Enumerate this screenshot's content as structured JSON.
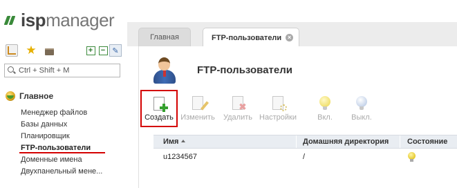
{
  "logo": {
    "part1": "isp",
    "part2": "manager"
  },
  "sidebar": {
    "tools": [
      "tree-icon",
      "star-icon",
      "briefcase-icon",
      "expand-icon",
      "collapse-icon",
      "pin-icon"
    ],
    "search": {
      "placeholder": "Ctrl + Shift + M"
    },
    "group": {
      "title": "Главное",
      "icon": "globe-icon"
    },
    "items": [
      {
        "label": "Менеджер файлов"
      },
      {
        "label": "Базы данных"
      },
      {
        "label": "Планировщик"
      },
      {
        "label": "FTP-пользователи",
        "active": true
      },
      {
        "label": "Доменные имена"
      },
      {
        "label": "Двухпанельный мене..."
      }
    ]
  },
  "tabs": [
    {
      "label": "Главная"
    },
    {
      "label": "FTP-пользователи",
      "active": true,
      "close": "×"
    }
  ],
  "page": {
    "title": "FTP-пользователи",
    "icon": "user-icon"
  },
  "toolbar": {
    "create": "Создать",
    "edit": "Изменить",
    "delete": "Удалить",
    "settings": "Настройки",
    "enable": "Вкл.",
    "disable": "Выкл."
  },
  "table": {
    "columns": {
      "name": "Имя",
      "home": "Домашняя директория",
      "state": "Состояние"
    },
    "rows": [
      {
        "name": "u1234567",
        "home": "/",
        "state": "bulb-on-icon"
      }
    ]
  },
  "colors": {
    "highlight": "#d40000",
    "accent_green": "#35a02e"
  }
}
